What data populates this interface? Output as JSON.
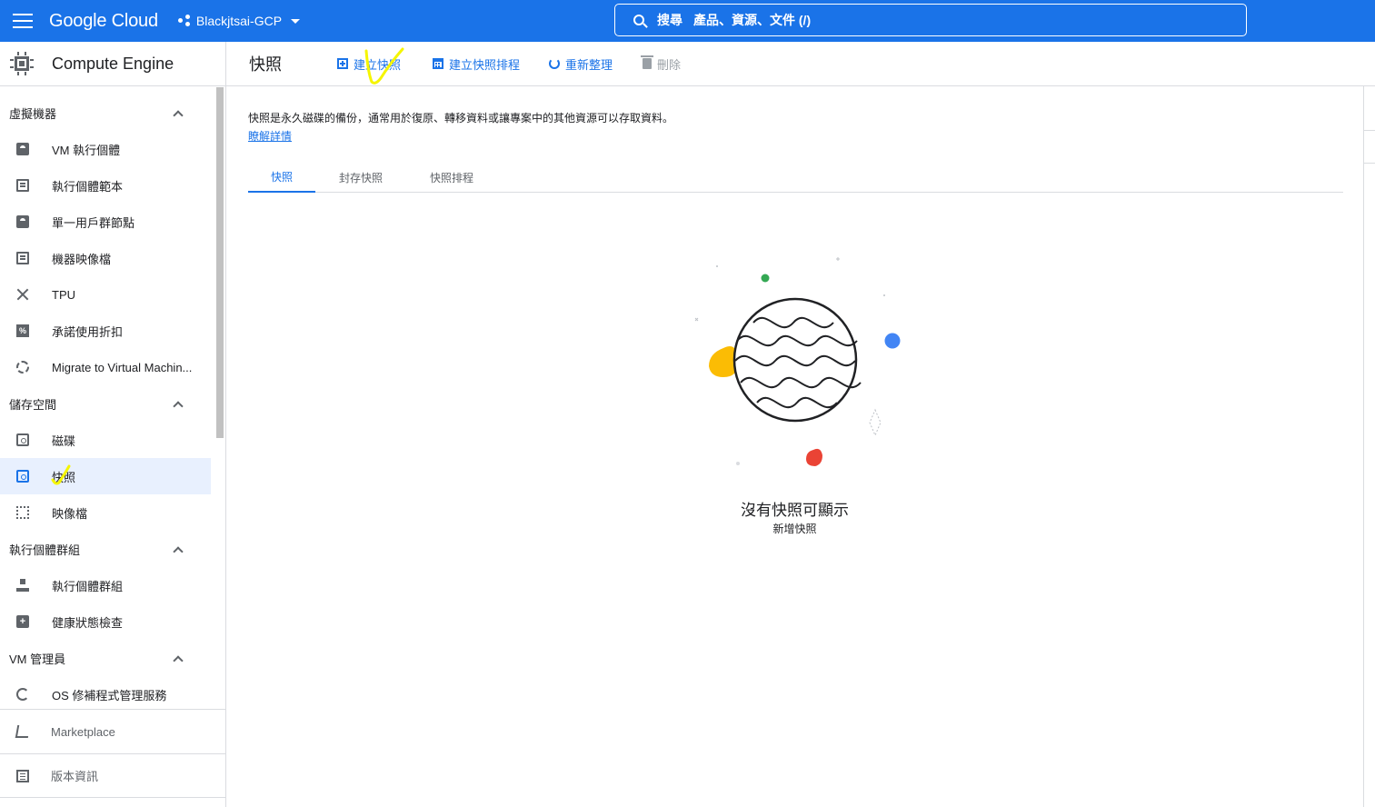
{
  "header": {
    "brand": "Google Cloud",
    "project": "Blackjtsai-GCP",
    "search_label": "搜尋",
    "search_hint": "產品、資源、文件 (/)"
  },
  "sidebar": {
    "product": "Compute Engine",
    "sections": [
      {
        "label": "虛擬機器",
        "items": [
          {
            "label": "VM 執行個體",
            "icon": "vm-instance-icon"
          },
          {
            "label": "執行個體範本",
            "icon": "instance-template-icon"
          },
          {
            "label": "單一用戶群節點",
            "icon": "sole-tenant-icon"
          },
          {
            "label": "機器映像檔",
            "icon": "machine-image-icon"
          },
          {
            "label": "TPU",
            "icon": "tpu-icon"
          },
          {
            "label": "承諾使用折扣",
            "icon": "percent-icon"
          },
          {
            "label": "Migrate to Virtual Machin...",
            "icon": "migrate-icon"
          }
        ]
      },
      {
        "label": "儲存空間",
        "items": [
          {
            "label": "磁碟",
            "icon": "disk-icon"
          },
          {
            "label": "快照",
            "icon": "snapshot-icon",
            "active": true
          },
          {
            "label": "映像檔",
            "icon": "image-icon"
          }
        ]
      },
      {
        "label": "執行個體群組",
        "items": [
          {
            "label": "執行個體群組",
            "icon": "instance-group-icon"
          },
          {
            "label": "健康狀態檢查",
            "icon": "health-check-icon"
          }
        ]
      },
      {
        "label": "VM 管理員",
        "items": [
          {
            "label": "OS 修補程式管理服務",
            "icon": "os-patch-icon"
          }
        ]
      }
    ],
    "footer": [
      {
        "label": "Marketplace",
        "icon": "cart-icon"
      },
      {
        "label": "版本資訊",
        "icon": "release-notes-icon"
      }
    ]
  },
  "toolbar": {
    "title": "快照",
    "create_snapshot": "建立快照",
    "create_schedule": "建立快照排程",
    "refresh": "重新整理",
    "delete": "刪除"
  },
  "main": {
    "description": "快照是永久磁碟的備份，通常用於復原、轉移資料或讓專案中的其他資源可以存取資料。",
    "learn_more": "瞭解詳情",
    "tabs": [
      {
        "label": "快照",
        "active": true
      },
      {
        "label": "封存快照"
      },
      {
        "label": "快照排程"
      }
    ],
    "empty_title": "沒有快照可顯示",
    "empty_subtitle": "新增快照"
  },
  "colors": {
    "brand_blue": "#1a73e8",
    "active_bg": "#e8f0fe",
    "accent_yellow": "#fbbc04",
    "accent_green": "#34a853",
    "accent_red": "#ea4335",
    "annotation": "#f5f500"
  }
}
